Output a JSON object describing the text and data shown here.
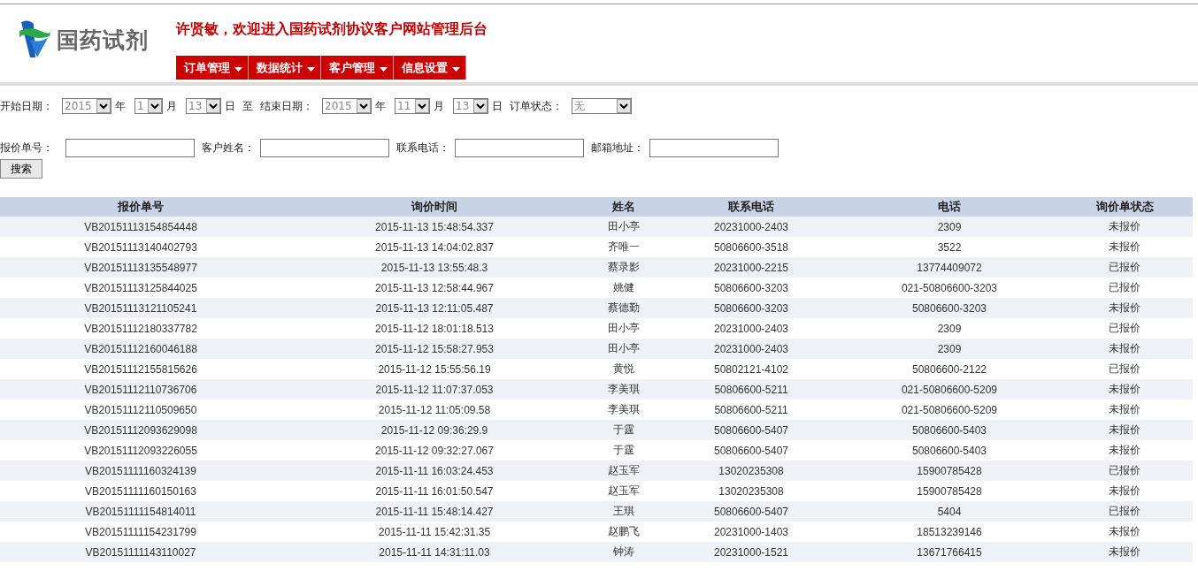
{
  "header": {
    "logo_text": "国药试剂",
    "welcome": "许贤敏，欢迎进入国药试剂协议客户网站管理后台"
  },
  "nav": [
    {
      "label": "订单管理"
    },
    {
      "label": "数据统计"
    },
    {
      "label": "客户管理"
    },
    {
      "label": "信息设置"
    }
  ],
  "date_filters": [
    {
      "kind": "label",
      "text": "开始日期："
    },
    {
      "kind": "date-select",
      "value": "2015"
    },
    {
      "kind": "label",
      "text": "年"
    },
    {
      "kind": "date-select",
      "value": "1"
    },
    {
      "kind": "label",
      "text": "月"
    },
    {
      "kind": "date-select",
      "value": "13"
    },
    {
      "kind": "label",
      "text": "日"
    },
    {
      "kind": "label",
      "text": "至"
    },
    {
      "kind": "label",
      "text": "结束日期："
    },
    {
      "kind": "date-select",
      "value": "2015"
    },
    {
      "kind": "label",
      "text": "年"
    },
    {
      "kind": "date-select",
      "value": "11"
    },
    {
      "kind": "label",
      "text": "月"
    },
    {
      "kind": "date-select",
      "value": "13"
    },
    {
      "kind": "label",
      "text": "日"
    },
    {
      "kind": "label",
      "text": "订单状态："
    },
    {
      "kind": "status-select",
      "value": "无"
    }
  ],
  "search_fields": [
    {
      "label": "报价单号："
    },
    {
      "label": "客户姓名："
    },
    {
      "label": "联系电话："
    },
    {
      "label": "邮箱地址："
    }
  ],
  "search_button": "搜索",
  "table": {
    "columns": [
      "报价单号",
      "询价时间",
      "姓名",
      "联系电话",
      "电话",
      "询价单状态"
    ],
    "rows": [
      [
        "VB20151113154854448",
        "2015-11-13 15:48:54.337",
        "田小亭",
        "20231000-2403",
        "2309",
        "未报价"
      ],
      [
        "VB20151113140402793",
        "2015-11-13 14:04:02.837",
        "齐唯一",
        "50806600-3518",
        "3522",
        "未报价"
      ],
      [
        "VB20151113135548977",
        "2015-11-13 13:55:48.3",
        "蔡录影",
        "20231000-2215",
        "13774409072",
        "已报价"
      ],
      [
        "VB20151113125844025",
        "2015-11-13 12:58:44.967",
        "姚健",
        "50806600-3203",
        "021-50806600-3203",
        "已报价"
      ],
      [
        "VB20151113121105241",
        "2015-11-13 12:11:05.487",
        "蔡德勤",
        "50806600-3203",
        "50806600-3203",
        "未报价"
      ],
      [
        "VB20151112180337782",
        "2015-11-12 18:01:18.513",
        "田小亭",
        "20231000-2403",
        "2309",
        "已报价"
      ],
      [
        "VB20151112160046188",
        "2015-11-12 15:58:27.953",
        "田小亭",
        "20231000-2403",
        "2309",
        "未报价"
      ],
      [
        "VB20151112155815626",
        "2015-11-12 15:55:56.19",
        "黄悦",
        "50802121-4102",
        "50806600-2122",
        "已报价"
      ],
      [
        "VB20151112110736706",
        "2015-11-12 11:07:37.053",
        "李美琪",
        "50806600-5211",
        "021-50806600-5209",
        "未报价"
      ],
      [
        "VB20151112110509650",
        "2015-11-12 11:05:09.58",
        "李美琪",
        "50806600-5211",
        "021-50806600-5209",
        "未报价"
      ],
      [
        "VB20151112093629098",
        "2015-11-12 09:36:29.9",
        "于霆",
        "50806600-5407",
        "50806600-5403",
        "未报价"
      ],
      [
        "VB20151112093226055",
        "2015-11-12 09:32:27.067",
        "于霆",
        "50806600-5407",
        "50806600-5403",
        "未报价"
      ],
      [
        "VB20151111160324139",
        "2015-11-11 16:03:24.453",
        "赵玉军",
        "13020235308",
        "15900785428",
        "已报价"
      ],
      [
        "VB20151111160150163",
        "2015-11-11 16:01:50.547",
        "赵玉军",
        "13020235308",
        "15900785428",
        "未报价"
      ],
      [
        "VB20151111154814011",
        "2015-11-11 15:48:14.427",
        "王琪",
        "50806600-5407",
        "5404",
        "已报价"
      ],
      [
        "VB20151111154231799",
        "2015-11-11 15:42:31.35",
        "赵鹏飞",
        "20231000-1403",
        "18513239146",
        "未报价"
      ],
      [
        "VB20151111143110027",
        "2015-11-11 14:31:11.03",
        "钟涛",
        "20231000-1521",
        "13671766415",
        "未报价"
      ]
    ]
  }
}
